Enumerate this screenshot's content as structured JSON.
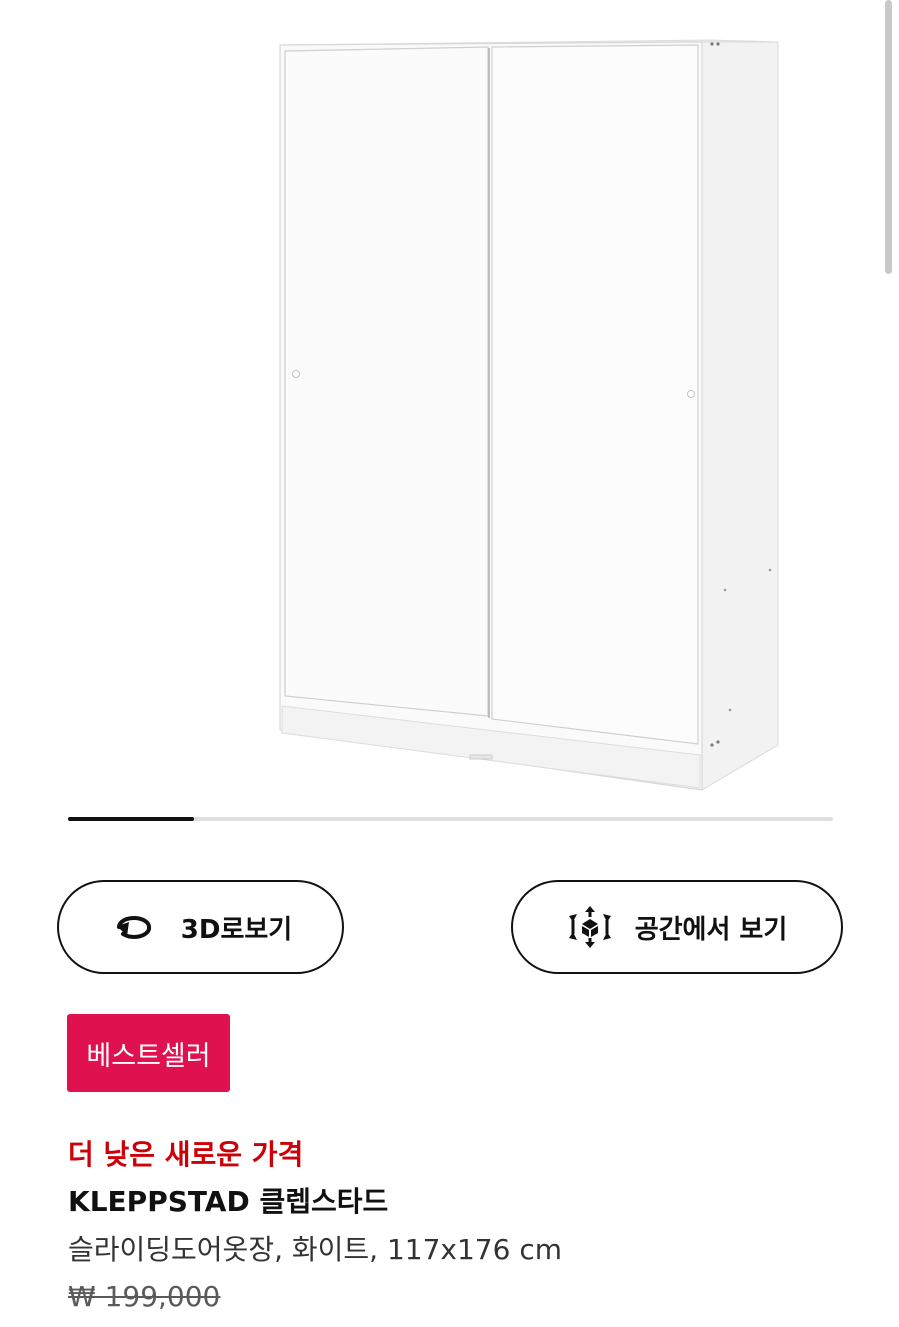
{
  "product_image": {
    "alt": "KLEPPSTAD 클렙스타드 슬라이딩도어옷장, 화이트"
  },
  "carousel": {
    "progress": 0.165
  },
  "actions": {
    "view_3d_label": "3D로보기",
    "view_3d_icon": "rotate-icon",
    "view_room_label": "공간에서 보기",
    "view_room_icon": "ar-cube-icon"
  },
  "badge": {
    "label": "베스트셀러",
    "color": "#e0114f"
  },
  "product": {
    "price_note": "더 낮은 새로운 가격",
    "price_note_color": "#cc0008",
    "name": "KLEPPSTAD 클렙스타드",
    "description": "슬라이딩도어옷장, 화이트, 117x176 cm",
    "old_price": "₩ 199,000"
  }
}
